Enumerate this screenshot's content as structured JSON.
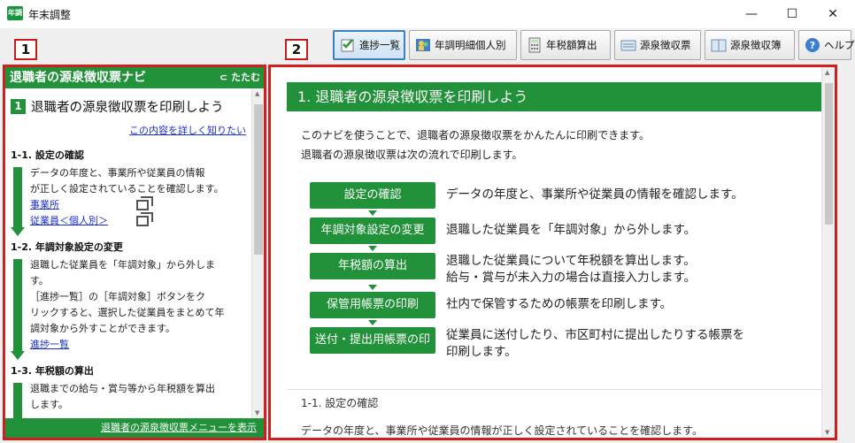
{
  "window": {
    "icon_text": "年調",
    "title": "年末調整",
    "minimize": "—",
    "maximize": "☐",
    "close": "✕"
  },
  "toolbar": {
    "buttons": [
      {
        "label": "進捗一覧",
        "icon": "checklist-icon",
        "active": true
      },
      {
        "label": "年調明細個人別",
        "icon": "people-icon",
        "active": false
      },
      {
        "label": "年税額算出",
        "icon": "calculator-icon",
        "active": false
      },
      {
        "label": "源泉徴収票",
        "icon": "slip-icon",
        "active": false
      },
      {
        "label": "源泉徴収簿",
        "icon": "ledger-icon",
        "active": false
      },
      {
        "label": "ヘルプ",
        "icon": "help-icon",
        "active": false
      }
    ]
  },
  "labels": {
    "left": "1",
    "right": "2"
  },
  "nav": {
    "header": "退職者の源泉徴収票ナビ",
    "collapse": "たたむ",
    "title_num": "1",
    "title": "退職者の源泉徴収票を印刷しよう",
    "detail_link": "この内容を詳しく知りたい",
    "sections": [
      {
        "title": "1-1. 設定の確認",
        "lines": [
          "データの年度と、事業所や従業員の情報",
          "が正しく設定されていることを確認します。"
        ],
        "links": [
          "事業所",
          "従業員＜個人別＞"
        ]
      },
      {
        "title": "1-2. 年調対象設定の変更",
        "lines": [
          "退職した従業員を「年調対象」から外しま",
          "す。",
          "［進捗一覧］の［年調対象］ボタンをク",
          "リックすると、選択した従業員をまとめて年",
          "調対象から外すことができます。"
        ],
        "links": [
          "進捗一覧"
        ]
      },
      {
        "title": "1-3. 年税額の算出",
        "lines": [
          "退職までの給与・賞与等から年税額を算出",
          "します。"
        ],
        "links": []
      }
    ],
    "footer": "退職者の源泉徴収票メニューを表示"
  },
  "main": {
    "heading": "1. 退職者の源泉徴収票を印刷しよう",
    "intro": [
      "このナビを使うことで、退職者の源泉徴収票をかんたんに印刷できます。",
      "退職者の源泉徴収票は次の流れで印刷します。"
    ],
    "steps": [
      {
        "label": "設定の確認",
        "desc": [
          "データの年度と、事業所や従業員の情報を確認します。"
        ]
      },
      {
        "label": "年調対象設定の変更",
        "desc": [
          "退職した従業員を「年調対象」から外します。"
        ]
      },
      {
        "label": "年税額の算出",
        "desc": [
          "退職した従業員について年税額を算出します。",
          "給与・賞与が未入力の場合は直接入力します。"
        ]
      },
      {
        "label": "保管用帳票の印刷",
        "desc": [
          "社内で保管するための帳票を印刷します。"
        ]
      },
      {
        "label": "送付・提出用帳票の印刷",
        "desc": [
          "従業員に送付したり、市区町村に提出したりする帳票を",
          "印刷します。"
        ]
      }
    ],
    "sub_heading": "1-1. 設定の確認",
    "sub_text": "データの年度と、事業所や従業員の情報が正しく設定されていることを確認します。"
  }
}
